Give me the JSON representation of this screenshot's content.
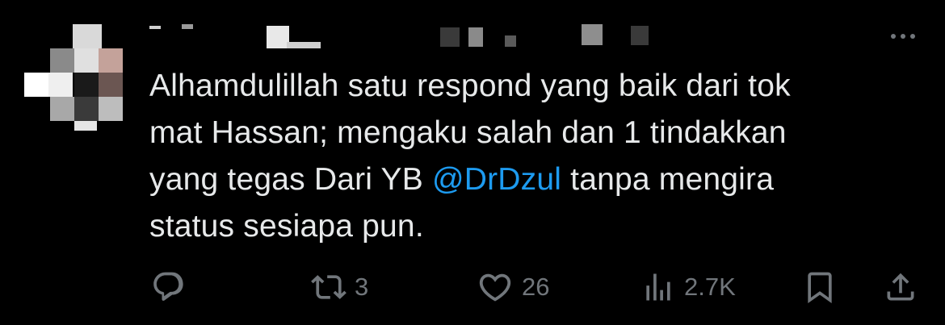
{
  "tweet": {
    "more_icon": "more-horizontal-icon",
    "text_parts": {
      "line1": "Alhamdulillah satu respond yang baik dari tok",
      "line2": "mat Hassan; mengaku salah dan 1 tindakkan",
      "line3_before": "yang tegas Dari YB ",
      "mention": "@DrDzul",
      "line3_after": " tanpa mengira",
      "line4": "status sesiapa pun."
    },
    "colors": {
      "background": "#000000",
      "text": "#e7e9ea",
      "mention": "#1d9bf0",
      "secondary": "#71767b"
    }
  },
  "actions": {
    "reply": {
      "icon": "reply-icon"
    },
    "retweet": {
      "icon": "retweet-icon",
      "count": "3"
    },
    "like": {
      "icon": "heart-icon",
      "count": "26"
    },
    "views": {
      "icon": "views-chart-icon",
      "count": "2.7K"
    },
    "bookmark": {
      "icon": "bookmark-icon"
    },
    "share": {
      "icon": "share-icon"
    }
  }
}
